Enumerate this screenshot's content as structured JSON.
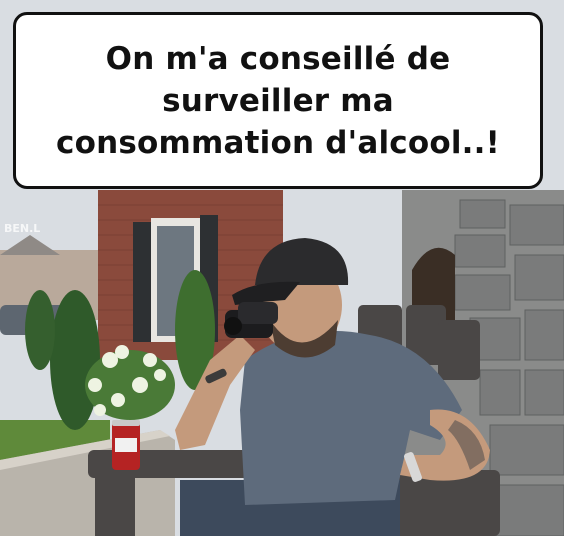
{
  "caption": {
    "lines": [
      "On m'a conseillé de",
      "surveiller ma",
      "consommation d'alcool..!"
    ]
  },
  "watermark": "BEN.L",
  "colors": {
    "sky": "#d9dde2",
    "brick": "#8a4a3c",
    "stone_wall": "#8a8b8a",
    "shirt": "#5e6b7c",
    "cap": "#2b2b2d",
    "chair": "#4a4746",
    "can_red": "#b52323",
    "grass": "#5f8a3a"
  },
  "icons": [
    "binoculars-icon",
    "beer-can-icon"
  ]
}
